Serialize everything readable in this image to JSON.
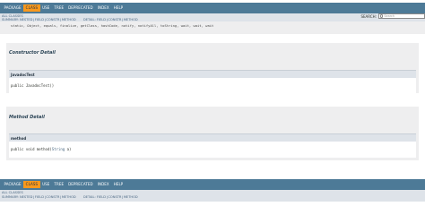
{
  "nav": {
    "items": [
      "PACKAGE",
      "CLASS",
      "USE",
      "TREE",
      "DEPRECATED",
      "INDEX",
      "HELP"
    ],
    "active": "CLASS"
  },
  "subnav": {
    "all_classes": "ALL CLASSES",
    "summary_prefix": "SUMMARY:",
    "summary_links": [
      "NESTED",
      "FIELD",
      "CONSTR",
      "METHOD"
    ],
    "detail_prefix": "DETAIL:",
    "detail_links": [
      "FIELD",
      "CONSTR",
      "METHOD"
    ]
  },
  "search": {
    "label": "SEARCH:",
    "placeholder": "Search"
  },
  "summary_cut_code": "static, Object, equals, finalize, getClass, hashCode, notify, notifyAll, toString, wait, wait, wait",
  "constructor_detail": {
    "title": "Constructor Detail",
    "member_name": "JavadocTest",
    "signature": "public JavadocTest()"
  },
  "method_detail": {
    "title": "Method Detail",
    "member_name": "method",
    "sig_prefix": "public void method(",
    "sig_type": "String",
    "sig_suffix": " a)"
  },
  "colors": {
    "nav_bg": "#4d7a97",
    "nav_active": "#f8981d",
    "subnav_bg": "#dee3e9",
    "block_bg": "#eeeeef",
    "heading": "#2c4557",
    "link": "#4a6782"
  }
}
